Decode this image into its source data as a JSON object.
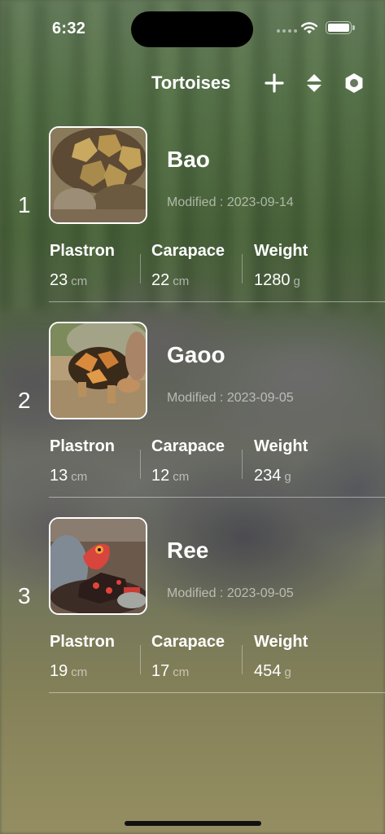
{
  "status_bar": {
    "time": "6:32",
    "icons": [
      "cellular-signal-icon",
      "wifi-icon",
      "battery-icon"
    ]
  },
  "nav": {
    "title": "Tortoises",
    "buttons": [
      "plus-icon",
      "sort-icon",
      "settings-icon"
    ]
  },
  "units": {
    "length": "cm",
    "weight": "g"
  },
  "metric_labels": {
    "plastron": "Plastron",
    "carapace": "Carapace",
    "weight": "Weight"
  },
  "tortoises": [
    {
      "index": "1",
      "name": "Bao",
      "modified": "Modified : 2023-09-14",
      "plastron": "23",
      "carapace": "22",
      "weight": "1280"
    },
    {
      "index": "2",
      "name": "Gaoo",
      "modified": "Modified : 2023-09-05",
      "plastron": "13",
      "carapace": "12",
      "weight": "234"
    },
    {
      "index": "3",
      "name": "Ree",
      "modified": "Modified : 2023-09-05",
      "plastron": "19",
      "carapace": "17",
      "weight": "454"
    }
  ],
  "colors": {
    "text": "#ffffff",
    "muted_text": "rgba(255,255,255,0.55)",
    "separator": "rgba(255,255,255,0.45)"
  }
}
